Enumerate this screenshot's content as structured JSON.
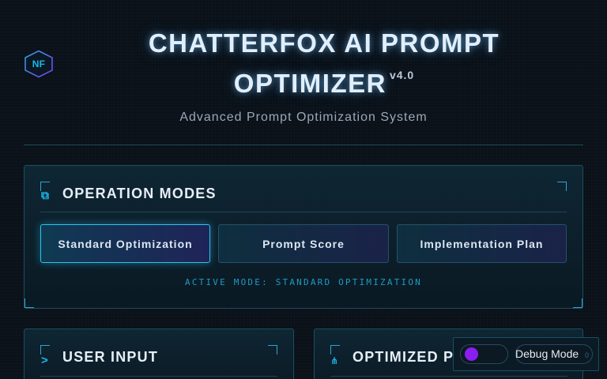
{
  "header": {
    "logo_text": "NF",
    "title_line1": "CHATTERFOX AI PROMPT",
    "title_line2": "OPTIMIZER",
    "version": "v4.0",
    "subtitle": "Advanced Prompt Optimization System"
  },
  "operation_modes": {
    "title": "OPERATION MODES",
    "modes": [
      {
        "label": "Standard Optimization",
        "active": true
      },
      {
        "label": "Prompt Score",
        "active": false
      },
      {
        "label": "Implementation Plan",
        "active": false
      }
    ],
    "active_mode_text": "ACTIVE MODE: STANDARD OPTIMIZATION"
  },
  "user_input": {
    "title": "USER INPUT",
    "icon": "terminal-prompt-icon"
  },
  "optimized_prompt": {
    "title": "OPTIMIZED PR",
    "icon": "branch-icon"
  },
  "debug": {
    "label": "Debug Mode",
    "chip_text": "0",
    "toggle_on": true
  },
  "colors": {
    "accent": "#1cb6ea",
    "toggle_knob": "#8a1ef0",
    "background": "#0a1118"
  }
}
